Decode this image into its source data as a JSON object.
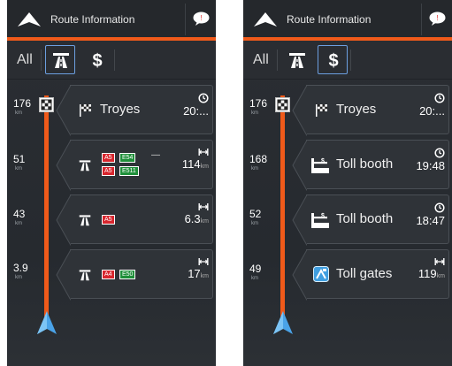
{
  "colors": {
    "accent": "#f05a1a",
    "active_tab_border": "#6c9fe0",
    "road_red": "#d8262e",
    "road_green": "#1f8f3a"
  },
  "left": {
    "header": {
      "title": "Route Information",
      "logo_icon": "navigation-logo-icon",
      "message_icon": "message-bubble-icon"
    },
    "filters": {
      "all": "All",
      "highway_icon": "highway-icon",
      "toll_icon": "dollar-icon",
      "active": "All"
    },
    "distances": [
      {
        "value": "176",
        "unit": "km"
      },
      {
        "value": "51",
        "unit": "km"
      },
      {
        "value": "43",
        "unit": "km"
      },
      {
        "value": "3.9",
        "unit": "km"
      }
    ],
    "events": [
      {
        "type": "destination",
        "icon": "checkered-flag-icon",
        "label": "Troyes",
        "metric_icon": "clock-icon",
        "value": "20:...",
        "unit": ""
      },
      {
        "type": "highway",
        "icon": "highway-icon",
        "roads_row1": [
          "A5",
          "E54"
        ],
        "dash": "—",
        "roads_row2": [
          "A5",
          "E511"
        ],
        "metric_icon": "distance-icon",
        "value": "114",
        "unit": "km"
      },
      {
        "type": "highway",
        "icon": "highway-icon",
        "roads_row1": [
          "A5"
        ],
        "metric_icon": "distance-icon",
        "value": "6.3",
        "unit": "km"
      },
      {
        "type": "highway",
        "icon": "highway-icon",
        "roads_row1": [
          "A4",
          "E50"
        ],
        "metric_icon": "distance-icon",
        "value": "17",
        "unit": "km"
      }
    ]
  },
  "right": {
    "header": {
      "title": "Route Information",
      "logo_icon": "navigation-logo-icon",
      "message_icon": "message-bubble-icon"
    },
    "filters": {
      "all": "All",
      "highway_icon": "highway-icon",
      "toll_icon": "dollar-icon",
      "active": "toll"
    },
    "distances": [
      {
        "value": "176",
        "unit": "km"
      },
      {
        "value": "168",
        "unit": "km"
      },
      {
        "value": "52",
        "unit": "km"
      },
      {
        "value": "49",
        "unit": "km"
      }
    ],
    "events": [
      {
        "type": "destination",
        "icon": "checkered-flag-icon",
        "label": "Troyes",
        "metric_icon": "clock-icon",
        "value": "20:...",
        "unit": ""
      },
      {
        "type": "toll",
        "icon": "toll-booth-icon",
        "label": "Toll booth",
        "metric_icon": "clock-icon",
        "value": "19:48",
        "unit": ""
      },
      {
        "type": "toll",
        "icon": "toll-booth-icon",
        "label": "Toll booth",
        "metric_icon": "clock-icon",
        "value": "18:47",
        "unit": ""
      },
      {
        "type": "toll",
        "icon": "toll-gates-icon",
        "label": "Toll gates",
        "metric_icon": "distance-icon",
        "value": "119",
        "unit": "km"
      }
    ]
  }
}
